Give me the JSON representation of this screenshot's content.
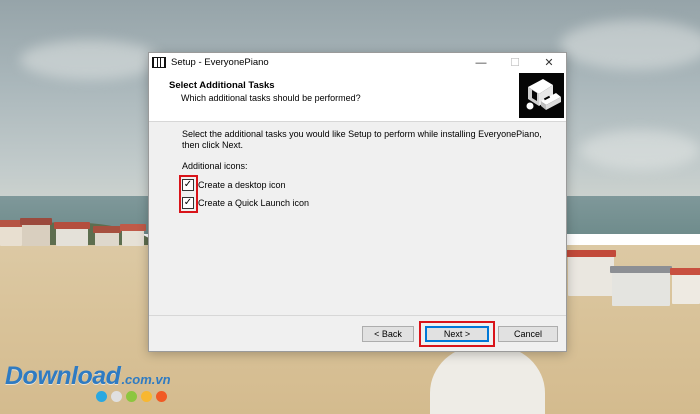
{
  "window": {
    "title": "Setup - EveryonePiano",
    "controls": {
      "minimize": "—",
      "maximize": "☐",
      "close": "✕"
    }
  },
  "header": {
    "title": "Select Additional Tasks",
    "subtitle": "Which additional tasks should be performed?",
    "image_icon": "installer-computer-icon"
  },
  "content": {
    "intro": "Select the additional tasks you would like Setup to perform while installing EveryonePiano, then click Next.",
    "group_label": "Additional icons:",
    "tasks": [
      {
        "label": "Create a desktop icon",
        "checked": true
      },
      {
        "label": "Create a Quick Launch icon",
        "checked": true
      }
    ]
  },
  "buttons": {
    "back": "< Back",
    "next": "Next >",
    "cancel": "Cancel"
  },
  "highlight_color": "#d9141a",
  "watermark": {
    "brand": "Download",
    "tld": ".com.vn",
    "dot_colors": [
      "#2aa8e0",
      "#e0e0e0",
      "#8cc63f",
      "#f7b731",
      "#f15a24"
    ]
  }
}
